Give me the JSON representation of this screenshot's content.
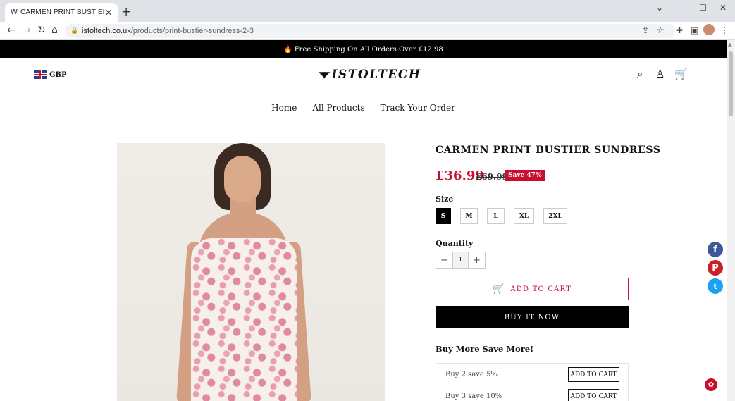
{
  "browser": {
    "tab_title": "CARMEN PRINT BUSTIER SUNDRESS",
    "tab_favicon": "W",
    "url_domain": "istoltech.co.uk",
    "url_path": "/products/print-bustier-sundress-2-3"
  },
  "announcement": {
    "icon": "fire-icon",
    "text": "Free Shipping On All Orders Over £12.98"
  },
  "header": {
    "currency": "GBP",
    "logo": "ISTOLTECH",
    "nav": [
      "Home",
      "All Products",
      "Track Your Order"
    ]
  },
  "product": {
    "title": "CARMEN PRINT BUSTIER SUNDRESS",
    "price": "£36.99",
    "old_price": "£69.99",
    "save_badge": "Save 47%",
    "size_label": "Size",
    "sizes": [
      "S",
      "M",
      "L",
      "XL",
      "2XL"
    ],
    "selected_size": "S",
    "quantity_label": "Quantity",
    "quantity": "1",
    "add_to_cart": "ADD TO CART",
    "buy_now": "BUY IT NOW",
    "bundle_title": "Buy More Save More!",
    "offers": [
      {
        "label": "Buy 2 save 5%",
        "button": "ADD TO CART"
      },
      {
        "label": "Buy 3 save 10%",
        "button": "ADD TO CART"
      }
    ]
  },
  "colors": {
    "accent": "#c8102e",
    "facebook": "#3b5998",
    "pinterest": "#cb2027",
    "twitter": "#1da1f2"
  }
}
